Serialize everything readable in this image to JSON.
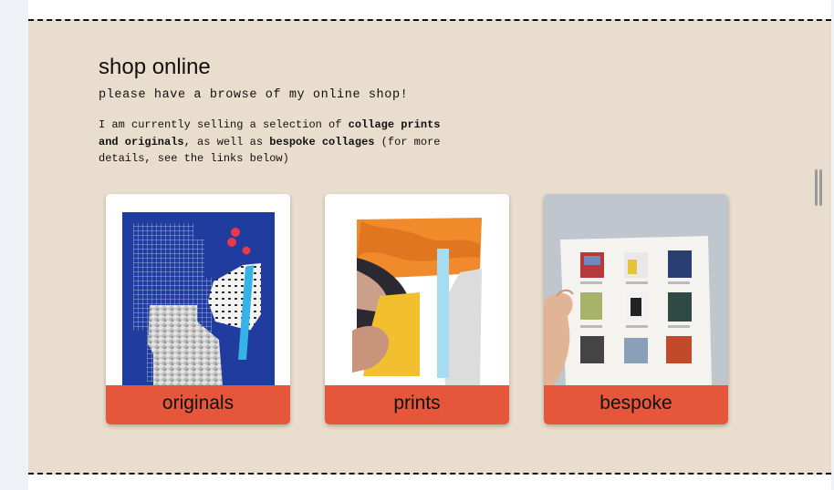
{
  "shop": {
    "title": "shop online",
    "subtitle": "please have a browse of my online shop!",
    "description": {
      "part1": "I am currently selling a selection of ",
      "bold1": "collage prints and originals",
      "part2": ", as well as ",
      "bold2": "bespoke collages",
      "part3": " (for more details, see the links below)"
    }
  },
  "cards": [
    {
      "label": "originals"
    },
    {
      "label": "prints"
    },
    {
      "label": "bespoke"
    }
  ],
  "colors": {
    "section_bg": "#e9ddcd",
    "label_bg": "#e5563a",
    "collage_blue": "#1f3c9e",
    "collage_orange": "#f08a2b"
  }
}
